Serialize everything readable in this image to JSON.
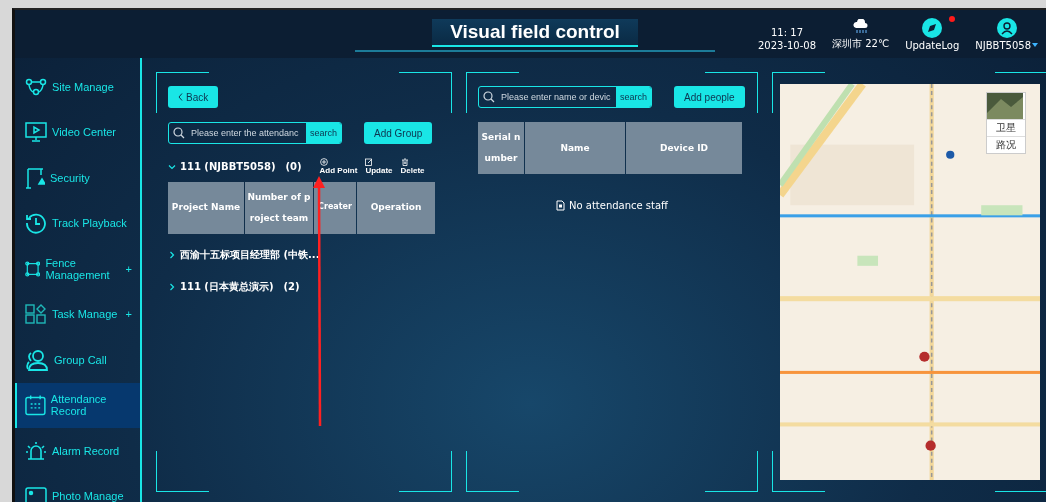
{
  "header": {
    "title": "Visual field control",
    "time": "11: 17",
    "date": "2023-10-08",
    "weather": "深圳市 22℃",
    "update_log": {
      "label": "UpdateLog",
      "has_new": true
    },
    "user": "NJBBT5058"
  },
  "sidebar": {
    "items": [
      {
        "label": "Site Manage",
        "selected": false
      },
      {
        "label": "Video Center",
        "selected": false
      },
      {
        "label": "Security",
        "selected": false
      },
      {
        "label": "Track Playback",
        "selected": false
      },
      {
        "label": "Fence Management",
        "expand_mark": "+",
        "selected": false
      },
      {
        "label": "Task Manage",
        "expand_mark": "+",
        "selected": false
      },
      {
        "label": "Group Call",
        "selected": false
      },
      {
        "label": "Attendance Record",
        "selected": true
      },
      {
        "label": "Alarm Record",
        "selected": false
      },
      {
        "label": "Photo Manage",
        "selected": false
      }
    ]
  },
  "groups_panel": {
    "back": "Back",
    "search": {
      "placeholder": "Please enter the attendanc",
      "button": "search"
    },
    "add_button": "Add Group",
    "groups": [
      {
        "label": "111 (NJBBT5058)",
        "count": "(0)",
        "expanded": true,
        "actions": [
          "Add Point",
          "Update",
          "Delete"
        ],
        "columns": [
          "Number of p roject team",
          "Creater",
          "Operation"
        ],
        "first_column": "Project Name"
      },
      {
        "label": "西渝十五标项目经理部 (中铁...",
        "expanded": false
      },
      {
        "label": "111 (日本黄总演示)",
        "count": "(2)",
        "expanded": false
      }
    ]
  },
  "staff_panel": {
    "search": {
      "placeholder": "Please enter name or devic",
      "button": "search"
    },
    "add_button": "Add people",
    "columns": [
      "Serial n umber",
      "Name",
      "Device ID"
    ],
    "empty": "No attendance staff"
  },
  "map": {
    "kind": "picture",
    "layers": [
      {
        "label": "卫星",
        "selected": false
      },
      {
        "label": "路况",
        "selected": false
      }
    ]
  }
}
